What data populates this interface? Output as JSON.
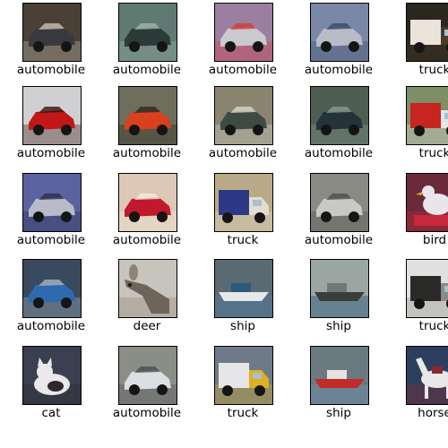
{
  "images": [
    {
      "label": "automobile",
      "subject": "automobile",
      "bg": "#4a4036",
      "fg": "#3a3a3e",
      "accent": "#c8c0b0"
    },
    {
      "label": "automobile",
      "subject": "automobile",
      "bg": "#5e7a72",
      "fg": "#2c3a38",
      "accent": "#9fb5ae"
    },
    {
      "label": "automobile",
      "subject": "automobile",
      "bg": "#9a7fa0",
      "fg": "#c9c9cf",
      "accent": "#d63a3a"
    },
    {
      "label": "automobile",
      "subject": "automobile",
      "bg": "#7a88a8",
      "fg": "#b8bcc8",
      "accent": "#3b4a6a"
    },
    {
      "label": "truck",
      "subject": "truck",
      "bg": "#2a2620",
      "fg": "#e8e4da",
      "accent": "#4a3a26"
    },
    {
      "label": "automobile",
      "subject": "automobile",
      "bg": "#d0d0d2",
      "fg": "#c01818",
      "accent": "#3a1010"
    },
    {
      "label": "automobile",
      "subject": "automobile",
      "bg": "#6e6e5a",
      "fg": "#d8401e",
      "accent": "#2a2a22"
    },
    {
      "label": "automobile",
      "subject": "automobile",
      "bg": "#8a8570",
      "fg": "#3e4a44",
      "accent": "#d8d6cc"
    },
    {
      "label": "automobile",
      "subject": "automobile",
      "bg": "#4e5e52",
      "fg": "#26323a",
      "accent": "#8a9a8e"
    },
    {
      "label": "truck",
      "subject": "truck",
      "bg": "#7e8e66",
      "fg": "#c82420",
      "accent": "#e6e6e6"
    },
    {
      "label": "automobile",
      "subject": "automobile",
      "bg": "#5a62a0",
      "fg": "#b8bcc8",
      "accent": "#2a2e4a"
    },
    {
      "label": "automobile",
      "subject": "automobile",
      "bg": "#dcc8b4",
      "fg": "#c0182c",
      "accent": "#f4ece2"
    },
    {
      "label": "truck",
      "subject": "truck",
      "bg": "#b8aa88",
      "fg": "#2c3a86",
      "accent": "#e2ddd0"
    },
    {
      "label": "automobile",
      "subject": "automobile",
      "bg": "#8a8a84",
      "fg": "#c8c8c4",
      "accent": "#4e4e48"
    },
    {
      "label": "bird",
      "subject": "bird",
      "bg": "#6a2a3a",
      "fg": "#e8e6ea",
      "accent": "#c8283c"
    },
    {
      "label": "automobile",
      "subject": "automobile",
      "bg": "#3a4a5e",
      "fg": "#2e6aae",
      "accent": "#a8b4c0"
    },
    {
      "label": "deer",
      "subject": "deer",
      "bg": "#c6c4bc",
      "fg": "#6e6458",
      "accent": "#8e8476"
    },
    {
      "label": "ship",
      "subject": "ship",
      "bg": "#5a6a72",
      "fg": "#e6e8ea",
      "accent": "#2e5a7a"
    },
    {
      "label": "ship",
      "subject": "ship",
      "bg": "#9aa6a2",
      "fg": "#3a3e38",
      "accent": "#6e7a76"
    },
    {
      "label": "truck",
      "subject": "truck",
      "bg": "#e0e0de",
      "fg": "#2a2a28",
      "accent": "#8a8a86"
    },
    {
      "label": "cat",
      "subject": "cat",
      "bg": "#3a4050",
      "fg": "#eae8ea",
      "accent": "#2a2a2e"
    },
    {
      "label": "automobile",
      "subject": "automobile",
      "bg": "#8a8e86",
      "fg": "#dcdee2",
      "accent": "#4a4e52"
    },
    {
      "label": "truck",
      "subject": "truck",
      "bg": "#6e7a88",
      "fg": "#e6e6e8",
      "accent": "#e0b020"
    },
    {
      "label": "ship",
      "subject": "ship",
      "bg": "#6a7a80",
      "fg": "#c42a2a",
      "accent": "#e6e2dc"
    },
    {
      "label": "horse",
      "subject": "horse",
      "bg": "#2e3e5e",
      "fg": "#e8e8e8",
      "accent": "#8a2a2a"
    }
  ]
}
